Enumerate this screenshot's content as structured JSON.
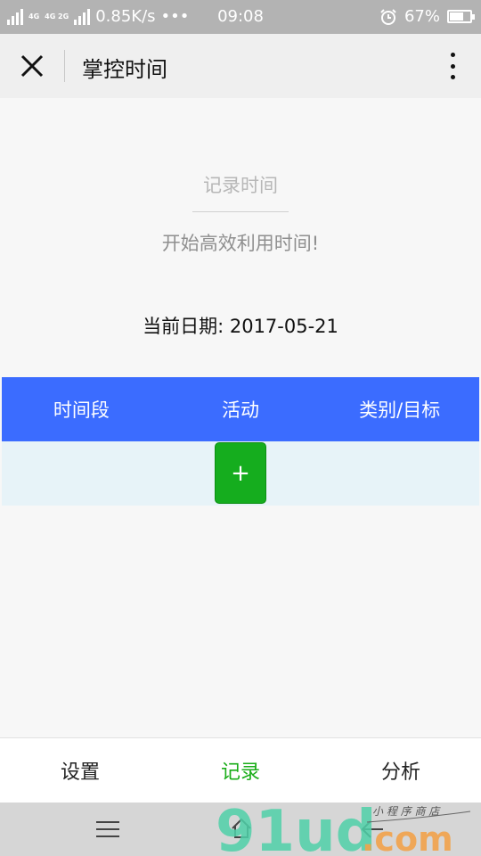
{
  "status_bar": {
    "net_top": "4G",
    "net_bottom": "4G 2G",
    "speed": "0.85K/s",
    "dots": "•••",
    "time": "09:08",
    "battery": "67%",
    "battery_level": 0.67
  },
  "header": {
    "title": "掌控时间",
    "close_icon": "close-icon",
    "more_icon": "more-vertical-icon"
  },
  "main": {
    "record_title": "记录时间",
    "record_subtitle": "开始高效利用时间!",
    "date_line": "当前日期: 2017-05-21"
  },
  "table": {
    "columns": [
      "时间段",
      "活动",
      "类别/目标"
    ],
    "add_label": "+"
  },
  "tabs": [
    {
      "label": "设置",
      "active": false
    },
    {
      "label": "记录",
      "active": true
    },
    {
      "label": "分析",
      "active": false
    }
  ],
  "colors": {
    "header_blue": "#3b6cff",
    "add_green": "#15ad1e",
    "active_tab": "#1aad19"
  },
  "watermark": {
    "text": "91ud.com",
    "tagline": "小程序商店"
  }
}
